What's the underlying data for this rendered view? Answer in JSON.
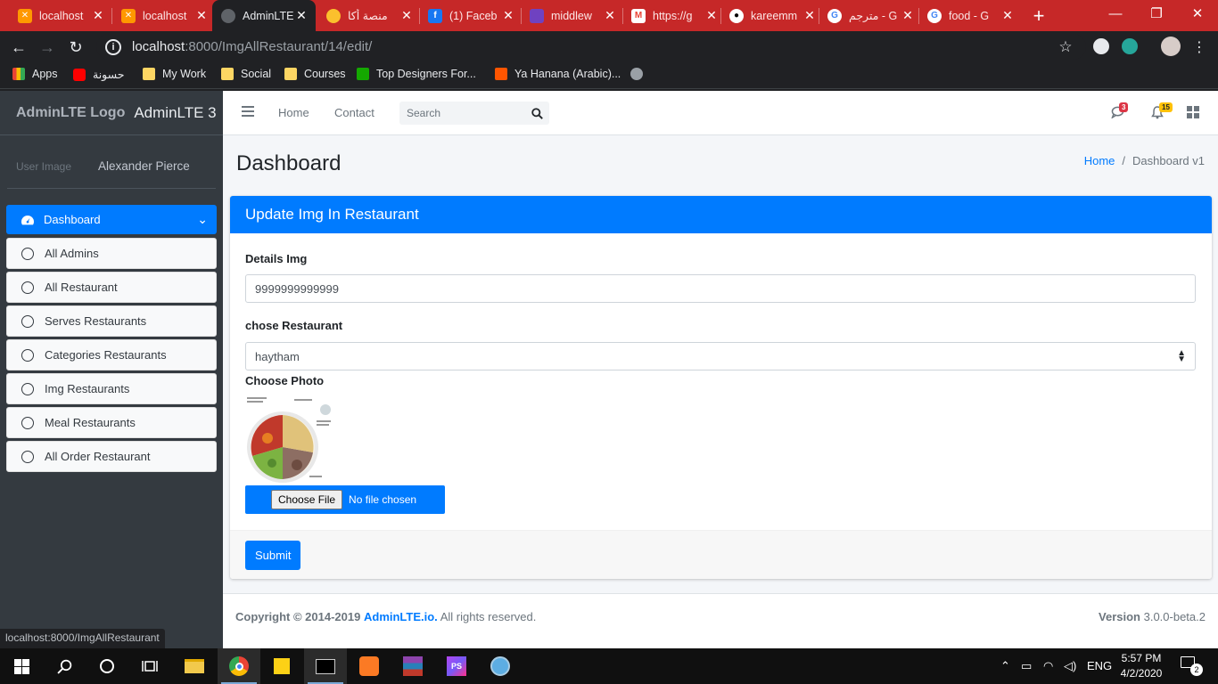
{
  "browser": {
    "tabs": [
      {
        "label": "localhost",
        "fav_color": "#ff9800",
        "active": false
      },
      {
        "label": "localhost",
        "fav_color": "#ff9800",
        "active": false
      },
      {
        "label": "AdminLTE",
        "fav_color": "#5f6368",
        "active": true
      },
      {
        "label": "منصة أكا",
        "fav_color": "#fbc02d",
        "active": false
      },
      {
        "label": "(1) Faceb",
        "fav_color": "#1877f2",
        "active": false
      },
      {
        "label": "middlew",
        "fav_color": "#6f42c1",
        "active": false
      },
      {
        "label": "https://g",
        "fav_color": "#ea4335",
        "active": false
      },
      {
        "label": "kareemm",
        "fav_color": "#000000",
        "active": false
      },
      {
        "label": "مترجم - G",
        "fav_color": "#4285f4",
        "active": false
      },
      {
        "label": "food - G",
        "fav_color": "#4285f4",
        "active": false
      }
    ],
    "new_tab": "+",
    "url_host": "localhost",
    "url_rest": ":8000/ImgAllRestaurant/14/edit/",
    "bookmarks": [
      {
        "label": "Apps",
        "color": "#ea4335"
      },
      {
        "label": "حسونة",
        "color": "#ff0000"
      },
      {
        "label": "My Work",
        "color": "#fdd663"
      },
      {
        "label": "Social",
        "color": "#fdd663"
      },
      {
        "label": "Courses",
        "color": "#fdd663"
      },
      {
        "label": "Top Designers For...",
        "color": "#14a800"
      },
      {
        "label": "Ya Hanana (Arabic)...",
        "color": "#ff5500"
      }
    ]
  },
  "sidebar": {
    "logo_alt": "AdminLTE Logo",
    "brand": "AdminLTE 3",
    "user_img_alt": "User Image",
    "user_name": "Alexander Pierce",
    "items": [
      {
        "label": "Dashboard",
        "active": true
      },
      {
        "label": "All Admins"
      },
      {
        "label": "All Restaurant"
      },
      {
        "label": "Serves Restaurants"
      },
      {
        "label": "Categories Restaurants"
      },
      {
        "label": "Img Restaurants"
      },
      {
        "label": "Meal Restaurants"
      },
      {
        "label": "All Order Restaurant"
      }
    ]
  },
  "header": {
    "home": "Home",
    "contact": "Contact",
    "search_placeholder": "Search",
    "messages_count": "3",
    "notifications_count": "15"
  },
  "content": {
    "title": "Dashboard",
    "breadcrumb_home": "Home",
    "breadcrumb_current": "Dashboard v1",
    "card_title": "Update Img In Restaurant",
    "details_label": "Details Img",
    "details_value": "9999999999999",
    "restaurant_label": "chose Restaurant",
    "restaurant_value": "haytham",
    "photo_label": "Choose Photo",
    "file_button": "Choose File",
    "file_status": "No file chosen",
    "submit": "Submit"
  },
  "footer": {
    "copyright_prefix": "Copyright © 2014-2019",
    "copyright_link": "AdminLTE.io.",
    "copyright_suffix": "All rights reserved.",
    "version_label": "Version",
    "version_value": "3.0.0-beta.2"
  },
  "status_url": "localhost:8000/ImgAllRestaurant",
  "taskbar": {
    "lang": "ENG",
    "time": "5:57 PM",
    "date": "4/2/2020",
    "notif_count": "2"
  },
  "colors": {
    "primary": "#007bff",
    "sidebar": "#343a40",
    "tabbar": "#c62828"
  }
}
